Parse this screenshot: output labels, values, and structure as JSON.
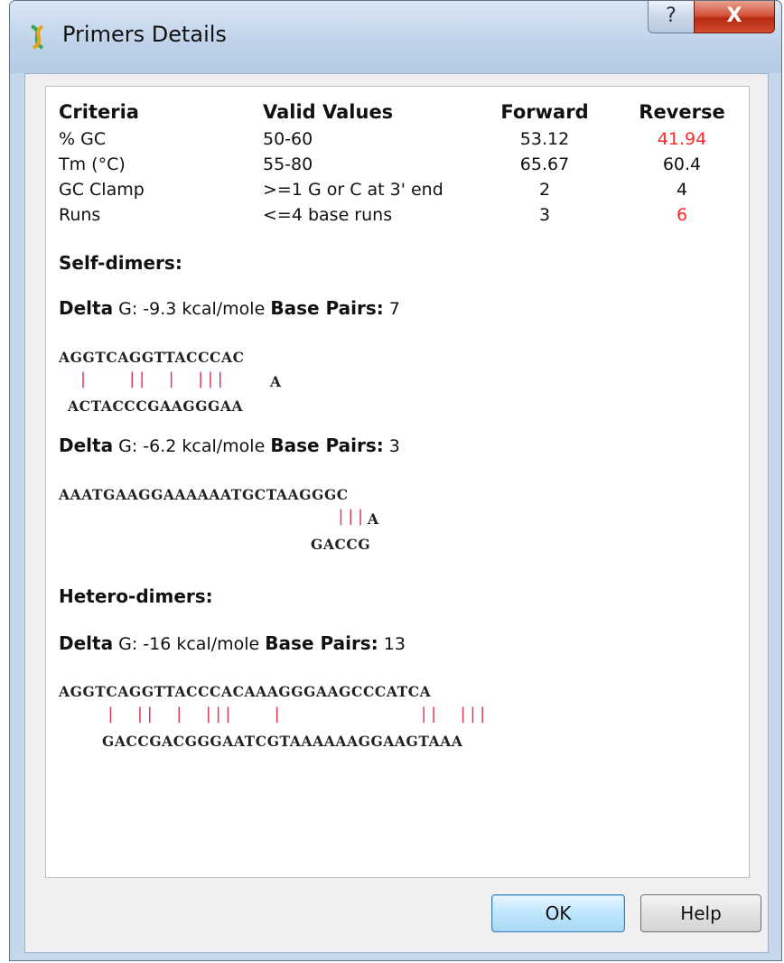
{
  "window": {
    "title": "Primers Details",
    "help_glyph": "?",
    "close_glyph": "X"
  },
  "table": {
    "headers": {
      "criteria": "Criteria",
      "valid": "Valid Values",
      "forward": "Forward",
      "reverse": "Reverse"
    },
    "rows": [
      {
        "criteria": "% GC",
        "valid": "50-60",
        "forward": "53.12",
        "reverse": "41.94",
        "reverse_color": "#ff2a2a"
      },
      {
        "criteria": "Tm (°C)",
        "valid": "55-80",
        "forward": "65.67",
        "reverse": "60.4",
        "reverse_color": "#111111"
      },
      {
        "criteria": "GC Clamp",
        "valid": ">=1 G or C at 3' end",
        "forward": "2",
        "reverse": "4",
        "reverse_color": "#111111"
      },
      {
        "criteria": "Runs",
        "valid": "<=4 base runs",
        "forward": "3",
        "reverse": "6",
        "reverse_color": "#ff2a2a"
      }
    ]
  },
  "self_dimers": {
    "title": "Self-dimers:",
    "entries": [
      {
        "delta_label": "Delta",
        "delta_text": "G: -9.3 kcal/mole",
        "bp_label": "Base Pairs:",
        "bp_value": "7",
        "seq_top": "AGGTCAGGTTACCCAC",
        "bars": "  |    ||  |  |||",
        "overhang": "A",
        "seq_bottom": "ACTACCCGAAGGGAA"
      },
      {
        "delta_label": "Delta",
        "delta_text": "G: -6.2 kcal/mole",
        "bp_label": "Base Pairs:",
        "bp_value": "3",
        "seq_top": "AAATGAAGGAAAAAATGCTAAGGGC",
        "bars": "|||",
        "overhang": "A",
        "seq_bottom": "GACCG"
      }
    ]
  },
  "hetero_dimers": {
    "title": "Hetero-dimers:",
    "entries": [
      {
        "delta_label": "Delta",
        "delta_text": "G: -16 kcal/mole",
        "bp_label": "Base Pairs:",
        "bp_value": "13",
        "seq_top": "AGGTCAGGTTACCCACAAAGGGAAGCCCATCA",
        "bars": "|  ||  |  |||    |              ||  |||",
        "overhang": "",
        "seq_bottom": "GACCGACGGGAATCGTAAAAAAGGAAGTAAA"
      }
    ]
  },
  "buttons": {
    "ok": "OK",
    "help": "Help"
  },
  "colors": {
    "mismatch_red": "#ff2a2a",
    "bond_pink": "#e03a5a"
  }
}
